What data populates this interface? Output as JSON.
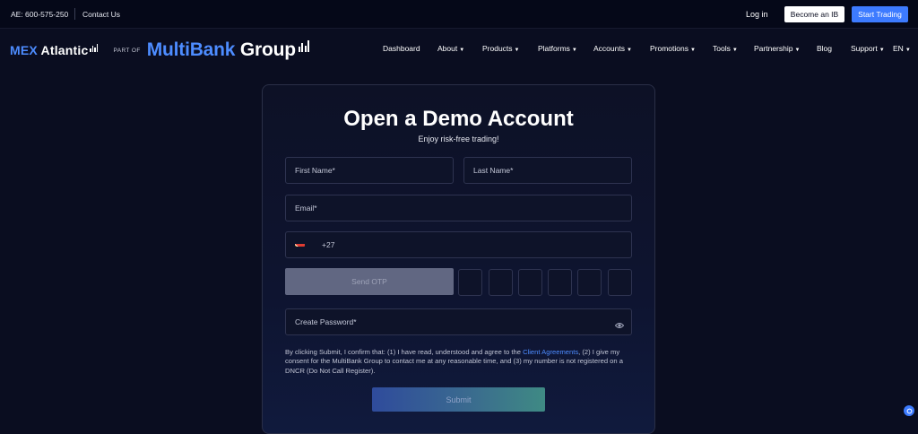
{
  "topbar": {
    "phone": "AE: 600-575-250",
    "contact": "Contact Us",
    "login": "Log in",
    "become_ib": "Become an IB",
    "start_trading": "Start Trading"
  },
  "logo": {
    "mex_accent": "MEX",
    "mex_rest": " Atlantic",
    "part_of": "PART OF",
    "multi": "MultiBank",
    "group": " Group"
  },
  "nav": {
    "items": [
      {
        "label": "Dashboard",
        "caret": ""
      },
      {
        "label": "About",
        "caret": "▼"
      },
      {
        "label": "Products",
        "caret": "▼"
      },
      {
        "label": "Platforms",
        "caret": "▼"
      },
      {
        "label": "Accounts",
        "caret": "▼"
      },
      {
        "label": "Promotions",
        "caret": "▼"
      },
      {
        "label": "Tools",
        "caret": "▼"
      },
      {
        "label": "Partnership",
        "caret": "▼"
      },
      {
        "label": "Blog",
        "caret": ""
      },
      {
        "label": "Support",
        "caret": "▼"
      },
      {
        "label": "EN",
        "caret": "▼"
      }
    ]
  },
  "form": {
    "title": "Open a Demo Account",
    "subtitle": "Enjoy risk-free trading!",
    "first_name": "First Name*",
    "last_name": "Last Name*",
    "email": "Email*",
    "phone_code": "+27",
    "send_otp": "Send OTP",
    "password": "Create Password*",
    "consent_before": "By clicking Submit, I confirm that: (1) I have read, understood and agree to the ",
    "consent_link": "Client Agreements",
    "consent_after": ", (2) I give my consent for the MultiBank Group to contact me at any reasonable time, and (3) my number is not registered on a DNCR (Do Not Call Register).",
    "submit": "Submit"
  },
  "icons": {
    "flag": "south-africa-flag-icon",
    "eye": "eye-icon",
    "chat": "chat-icon"
  },
  "colors": {
    "accent": "#4d8cff",
    "start_button": "#3d7bff",
    "background": "#0a0d20"
  }
}
